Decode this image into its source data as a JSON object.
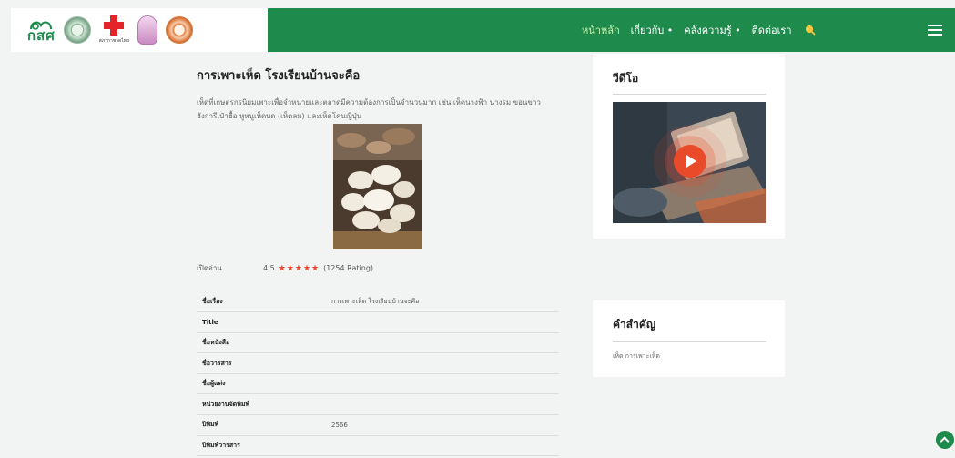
{
  "brand": {
    "gasf": "กสศ",
    "redcross_caption": "สภากาชาดไทย"
  },
  "nav": {
    "items": [
      "หน้าหลัก",
      "เกี่ยวกับ •",
      "คลังความรู้ •",
      "ติดต่อเรา"
    ],
    "active_color": "#c8f3b4",
    "bar_color": "#1e8b4c"
  },
  "article": {
    "title": "การเพาะเห็ด โรงเรียนบ้านจะคือ",
    "description": "เห็ดที่เกษตรกรนิยมเพาะเพื่อจำหน่ายและตลาดมีความต้องการเป็นจำนวนมาก เช่น เห็ดนางฟ้า นางรม ขอนขาว ฮังการีเป๋าฮื้อ หูหนูเห็ดบด (เห็ดลม) และเห็ดโคนญี่ปุ่น",
    "read_label": "เปิดอ่าน",
    "rating_value": "4.5",
    "stars": "★★★★★",
    "rating_count": "(1254 Rating)"
  },
  "meta": [
    {
      "key": "ชื่อเรื่อง",
      "value": "การเพาะเห็ด โรงเรียนบ้านจะคือ"
    },
    {
      "key": "Title",
      "value": ""
    },
    {
      "key": "ชื่อหนังสือ",
      "value": ""
    },
    {
      "key": "ชื่อวารสาร",
      "value": ""
    },
    {
      "key": "ชื่อผู้แต่ง",
      "value": ""
    },
    {
      "key": "หน่วยงานจัดพิมพ์",
      "value": ""
    },
    {
      "key": "ปีพิมพ์",
      "value": "2566"
    },
    {
      "key": "ปีพิมพ์วารสาร",
      "value": ""
    }
  ],
  "sidebar": {
    "video_title": "วีดีโอ",
    "keywords_title": "คำสำคัญ",
    "keywords": "เห็ด การเพาะเห็ด"
  },
  "icons": {
    "search": "search-icon",
    "menu": "hamburger-icon",
    "play": "play-icon",
    "scroll_top": "chevron-up-icon"
  }
}
